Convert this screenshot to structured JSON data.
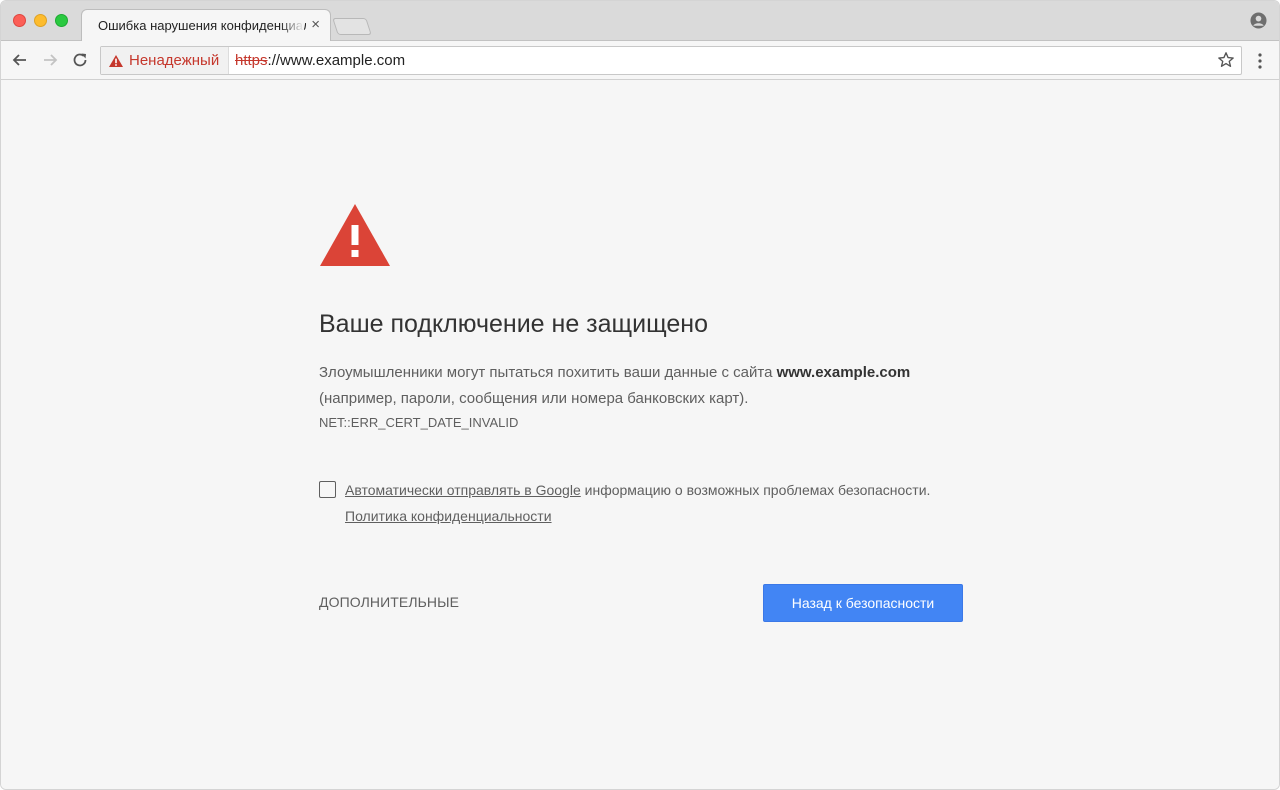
{
  "window": {
    "traffic_lights": [
      "close",
      "minimize",
      "maximize"
    ]
  },
  "tab": {
    "title": "Ошибка нарушения конфиденциальности",
    "close_glyph": "×"
  },
  "toolbar": {
    "security_label": "Ненадежный",
    "url_scheme": "https",
    "url_rest": "://www.example.com"
  },
  "interstitial": {
    "heading": "Ваше подключение не защищено",
    "body_prefix": "Злоумышленники могут пытаться похитить ваши данные с сайта ",
    "body_domain": "www.example.com",
    "body_suffix": " (например, пароли, сообщения или номера банковских карт).",
    "error_code": "NET::ERR_CERT_DATE_INVALID",
    "report_link": "Автоматически отправлять в Google",
    "report_rest": " информацию о возможных проблемах безопасности.",
    "report_checked": false,
    "privacy_link": "Политика конфиденциальности",
    "advanced_label": "ДОПОЛНИТЕЛЬНЫЕ",
    "back_button": "Назад к безопасности"
  },
  "colors": {
    "warning_red": "#db4437",
    "primary_blue": "#4285f4",
    "page_bg": "#f6f6f6"
  },
  "icons": [
    "back-arrow-icon",
    "forward-arrow-icon",
    "reload-icon",
    "warning-triangle-icon",
    "star-icon",
    "menu-dots-icon",
    "profile-icon"
  ]
}
